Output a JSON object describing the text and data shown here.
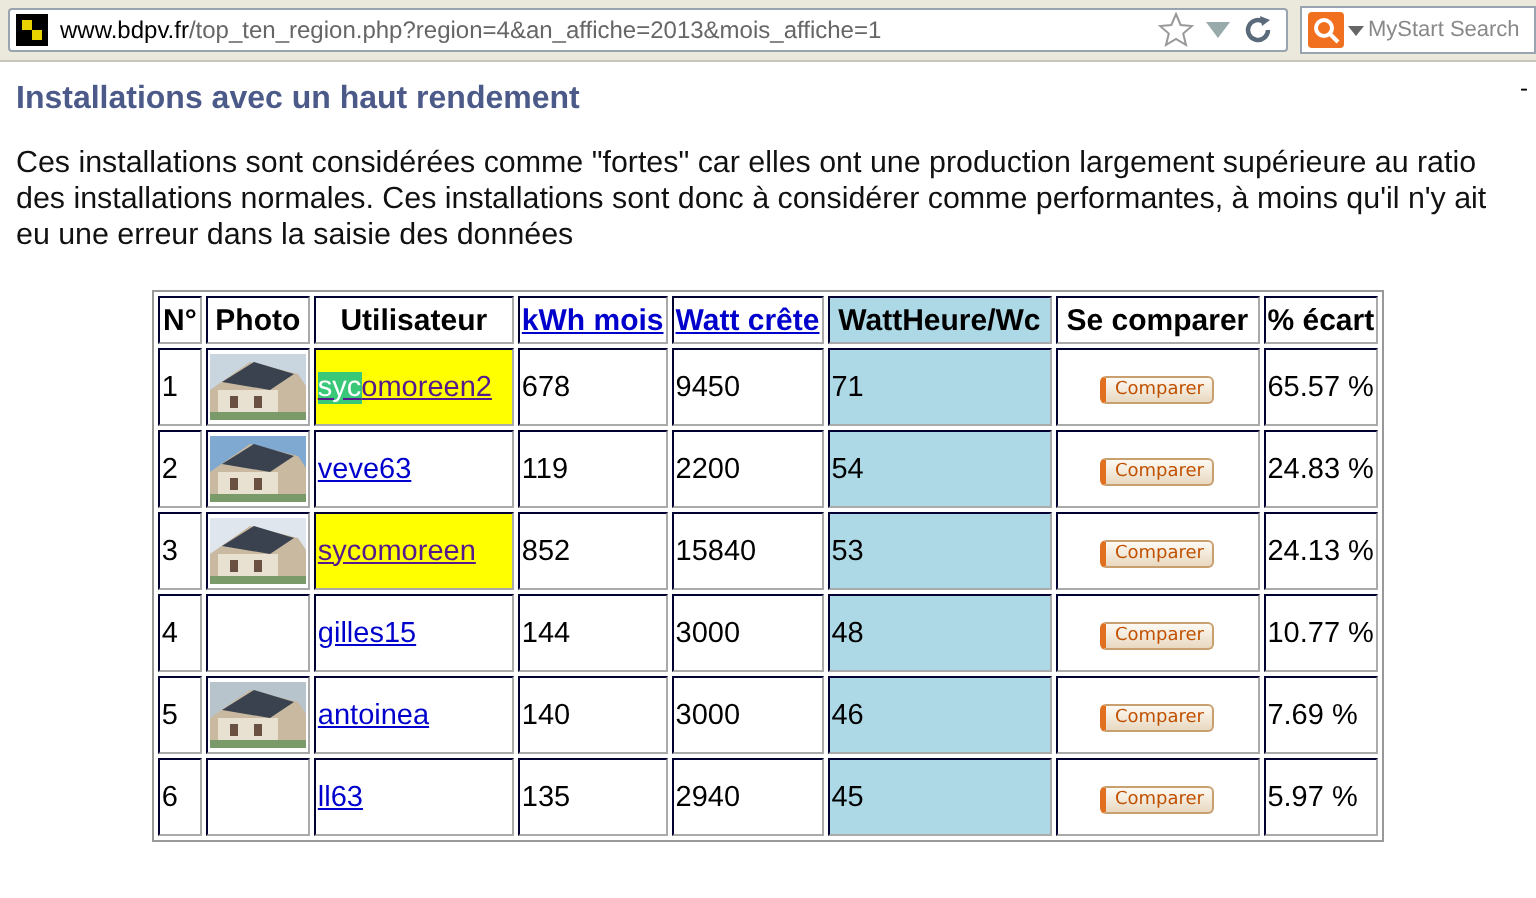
{
  "browser": {
    "url_host": "www.bdpv.fr",
    "url_path": "/top_ten_region.php?region=4&an_affiche=2013&mois_affiche=1",
    "search_placeholder": "MyStart Search"
  },
  "corner_mark": "-",
  "title": "Installations avec un haut rendement",
  "intro": "Ces installations sont considérées comme \"fortes\" car elles ont une production largement supérieure au ratio des installations normales. Ces installations sont donc à considérer comme performantes, à moins qu'il n'y ait eu une erreur dans la saisie des données",
  "table": {
    "columns": [
      {
        "label": "N°",
        "link": false
      },
      {
        "label": "Photo",
        "link": false
      },
      {
        "label": "Utilisateur",
        "link": false
      },
      {
        "label": "kWh mois",
        "link": true
      },
      {
        "label": "Watt crête",
        "link": true
      },
      {
        "label": "WattHeure/Wc",
        "link": false
      },
      {
        "label": "Se comparer",
        "link": false
      },
      {
        "label": "% écart",
        "link": false
      }
    ],
    "rows": [
      {
        "n": "1",
        "has_photo": true,
        "user_marked": "syc",
        "user": "omoreen2",
        "highlighted": true,
        "kwh": "678",
        "wc": "9450",
        "ratio": "71",
        "compare": "Comparer",
        "ecart": "65.57 %"
      },
      {
        "n": "2",
        "has_photo": true,
        "user": "veve63",
        "highlighted": false,
        "kwh": "119",
        "wc": "2200",
        "ratio": "54",
        "compare": "Comparer",
        "ecart": "24.83 %"
      },
      {
        "n": "3",
        "has_photo": true,
        "user": "sycomoreen",
        "highlighted": true,
        "kwh": "852",
        "wc": "15840",
        "ratio": "53",
        "compare": "Comparer",
        "ecart": "24.13 %"
      },
      {
        "n": "4",
        "has_photo": false,
        "user": "gilles15",
        "highlighted": false,
        "kwh": "144",
        "wc": "3000",
        "ratio": "48",
        "compare": "Comparer",
        "ecart": "10.77 %"
      },
      {
        "n": "5",
        "has_photo": true,
        "user": "antoinea",
        "highlighted": false,
        "kwh": "140",
        "wc": "3000",
        "ratio": "46",
        "compare": "Comparer",
        "ecart": "7.69 %"
      },
      {
        "n": "6",
        "has_photo": false,
        "user": "ll63",
        "highlighted": false,
        "kwh": "135",
        "wc": "2940",
        "ratio": "45",
        "compare": "Comparer",
        "ecart": "5.97 %"
      }
    ]
  }
}
